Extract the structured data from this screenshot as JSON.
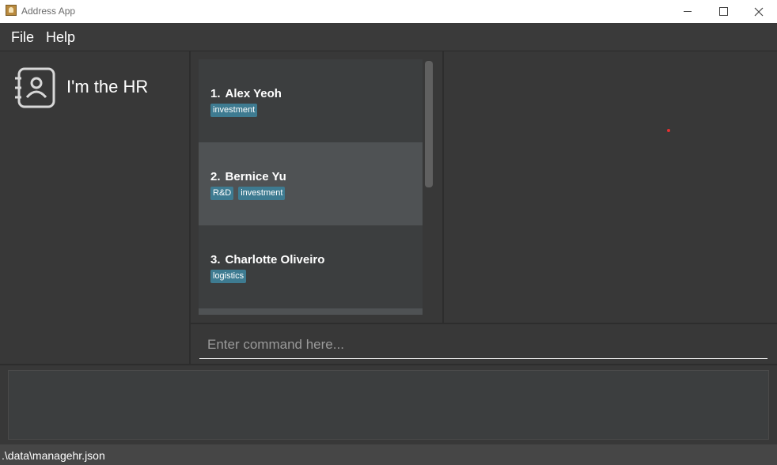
{
  "window": {
    "title": "Address App",
    "icon": "app-book-icon"
  },
  "menu": {
    "file": "File",
    "help": "Help"
  },
  "sidebar": {
    "logo_icon": "address-book-icon",
    "app_title": "I'm the HR"
  },
  "persons": [
    {
      "index": "1.",
      "name": "Alex Yeoh",
      "tags": [
        "investment"
      ],
      "selected": false
    },
    {
      "index": "2.",
      "name": "Bernice Yu",
      "tags": [
        "R&D",
        "investment"
      ],
      "selected": true
    },
    {
      "index": "3.",
      "name": "Charlotte Oliveiro",
      "tags": [
        "logistics"
      ],
      "selected": false
    }
  ],
  "command": {
    "placeholder": "Enter command here...",
    "value": ""
  },
  "result": {
    "text": ""
  },
  "status": {
    "path": ".\\data\\managehr.json"
  },
  "colors": {
    "background": "#383838",
    "card": "#3c3e3f",
    "card_selected": "#4f5254",
    "tag": "#3e7b91",
    "status_bar": "#464646"
  }
}
